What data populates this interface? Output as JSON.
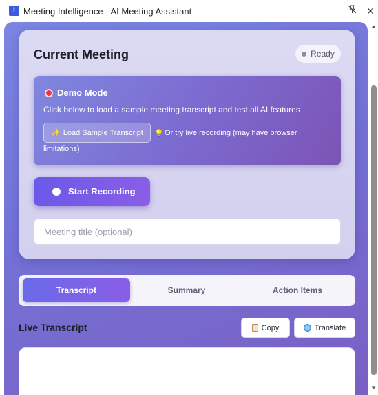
{
  "window": {
    "title": "Meeting Intelligence - AI Meeting Assistant",
    "pin_icon": "pin-off-icon",
    "close_label": "✕"
  },
  "meeting": {
    "title": "Current Meeting",
    "status": "Ready",
    "status_color": "#8b8f9a"
  },
  "demo": {
    "title": "Demo Mode",
    "description": "Click below to load a sample meeting transcript and test all AI features",
    "load_button": "Load Sample Transcript",
    "hint_line1": "Or try live recording (may have browser",
    "hint_line2": "limitations)"
  },
  "record": {
    "label": "Start Recording"
  },
  "meeting_title_input": {
    "placeholder": "Meeting title (optional)",
    "value": ""
  },
  "tabs": [
    {
      "label": "Transcript",
      "active": true
    },
    {
      "label": "Summary",
      "active": false
    },
    {
      "label": "Action Items",
      "active": false
    }
  ],
  "transcript": {
    "title": "Live Transcript",
    "copy_label": "Copy",
    "translate_label": "Translate"
  },
  "colors": {
    "accent": "#6a5ae8",
    "accent_end": "#8a5ee6",
    "background": "#7472d6"
  }
}
